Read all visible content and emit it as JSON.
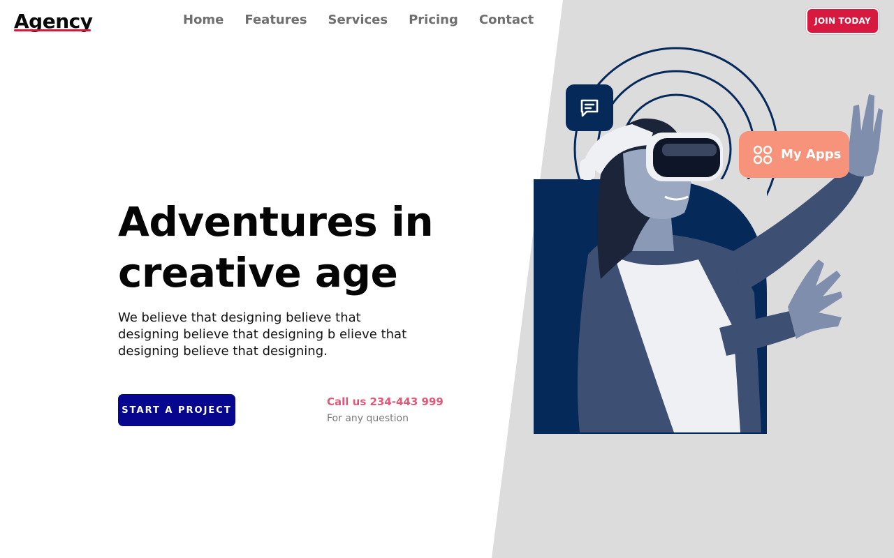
{
  "brand": {
    "name": "Agency",
    "accent": "#d7193f"
  },
  "nav": {
    "items": [
      {
        "label": "Home"
      },
      {
        "label": "Features"
      },
      {
        "label": "Services"
      },
      {
        "label": "Pricing"
      },
      {
        "label": "Contact"
      }
    ],
    "cta_label": "JOIN TODAY"
  },
  "hero": {
    "title_line1": "Adventures in",
    "title_line2": "creative age",
    "description": "We believe that designing believe that designing believe that designing b elieve that designing believe that designing.",
    "primary_button": "START A PROJECT",
    "call_text": "Call us 234-443 999",
    "call_subtext": "For any question"
  },
  "visual": {
    "chat_icon": "chat-icon",
    "apps_icon": "apps-grid-icon",
    "apps_label": "My Apps",
    "colors": {
      "navy": "#052a5a",
      "coral": "#f7937a",
      "panel_gray": "#dcdcdd",
      "button_blue": "#07068f",
      "call_pink": "#e25878"
    }
  }
}
